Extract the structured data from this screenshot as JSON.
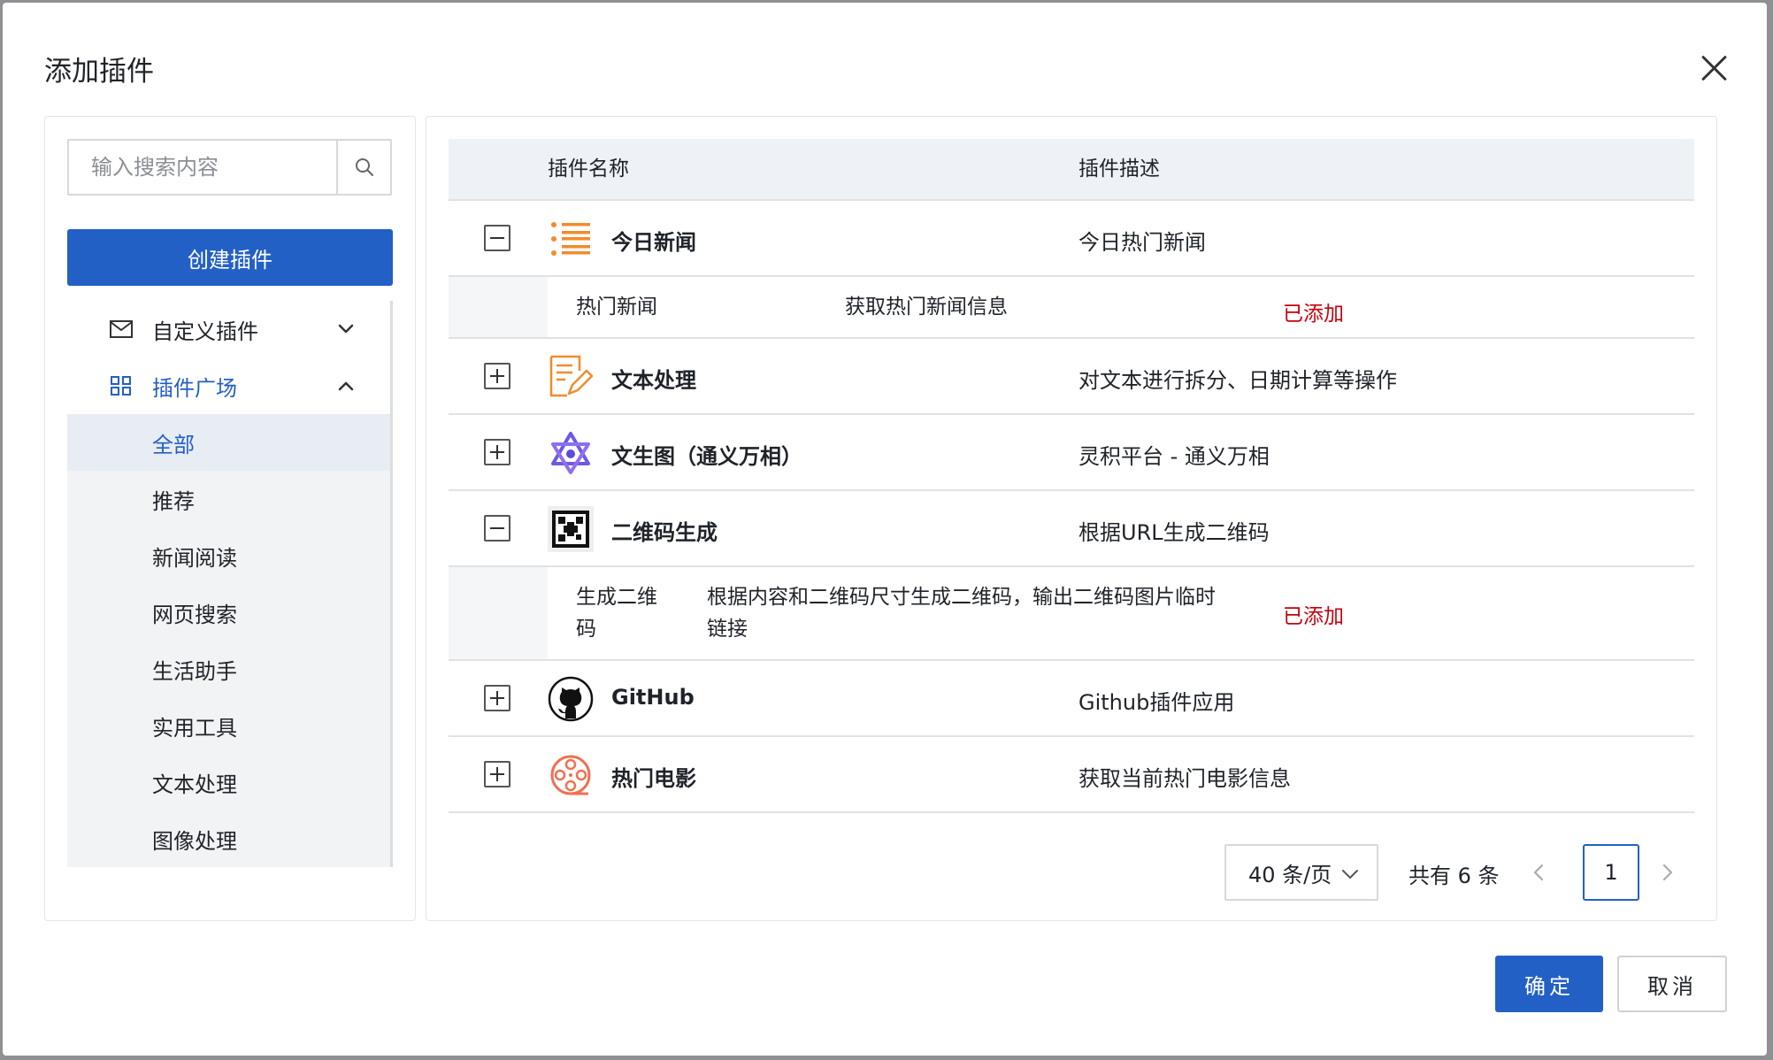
{
  "dialog": {
    "title": "添加插件"
  },
  "left": {
    "search_placeholder": "输入搜索内容",
    "create_label": "创建插件",
    "groups": [
      {
        "label": "自定义插件",
        "icon": "mail-icon",
        "expanded": false
      },
      {
        "label": "插件广场",
        "icon": "grid-icon",
        "expanded": true
      }
    ],
    "categories": [
      "全部",
      "推荐",
      "新闻阅读",
      "网页搜索",
      "生活助手",
      "实用工具",
      "文本处理",
      "图像处理"
    ],
    "active_category": "全部"
  },
  "table": {
    "headers": {
      "name": "插件名称",
      "desc": "插件描述"
    },
    "rows": [
      {
        "name": "今日新闻",
        "desc": "今日热门新闻",
        "expanded": true,
        "icon": "list-icon",
        "sub": {
          "name": "热门新闻",
          "desc": "获取热门新闻信息",
          "status": "已添加"
        }
      },
      {
        "name": "文本处理",
        "desc": "对文本进行拆分、日期计算等操作",
        "expanded": false,
        "icon": "note-edit-icon"
      },
      {
        "name": "文生图（通义万相）",
        "desc": "灵积平台 - 通义万相",
        "expanded": false,
        "icon": "tongyi-logo-icon"
      },
      {
        "name": "二维码生成",
        "desc": "根据URL生成二维码",
        "expanded": true,
        "icon": "qrcode-icon",
        "sub": {
          "name_line1": "生成二维",
          "name_line2": "码",
          "desc_line1": "根据内容和二维码尺寸生成二维码，输出二维码图片临时",
          "desc_line2": "链接",
          "status": "已添加"
        }
      },
      {
        "name": "GitHub",
        "desc": "Github插件应用",
        "expanded": false,
        "icon": "github-icon"
      },
      {
        "name": "热门电影",
        "desc": "获取当前热门电影信息",
        "expanded": false,
        "icon": "film-reel-icon"
      }
    ]
  },
  "pagination": {
    "page_size": "40 条/页",
    "total": "共有 6 条",
    "current": "1"
  },
  "footer": {
    "ok": "确定",
    "cancel": "取消"
  },
  "colors": {
    "primary": "#2360c6",
    "added": "#c7000b",
    "accent_orange": "#f08c2c"
  }
}
